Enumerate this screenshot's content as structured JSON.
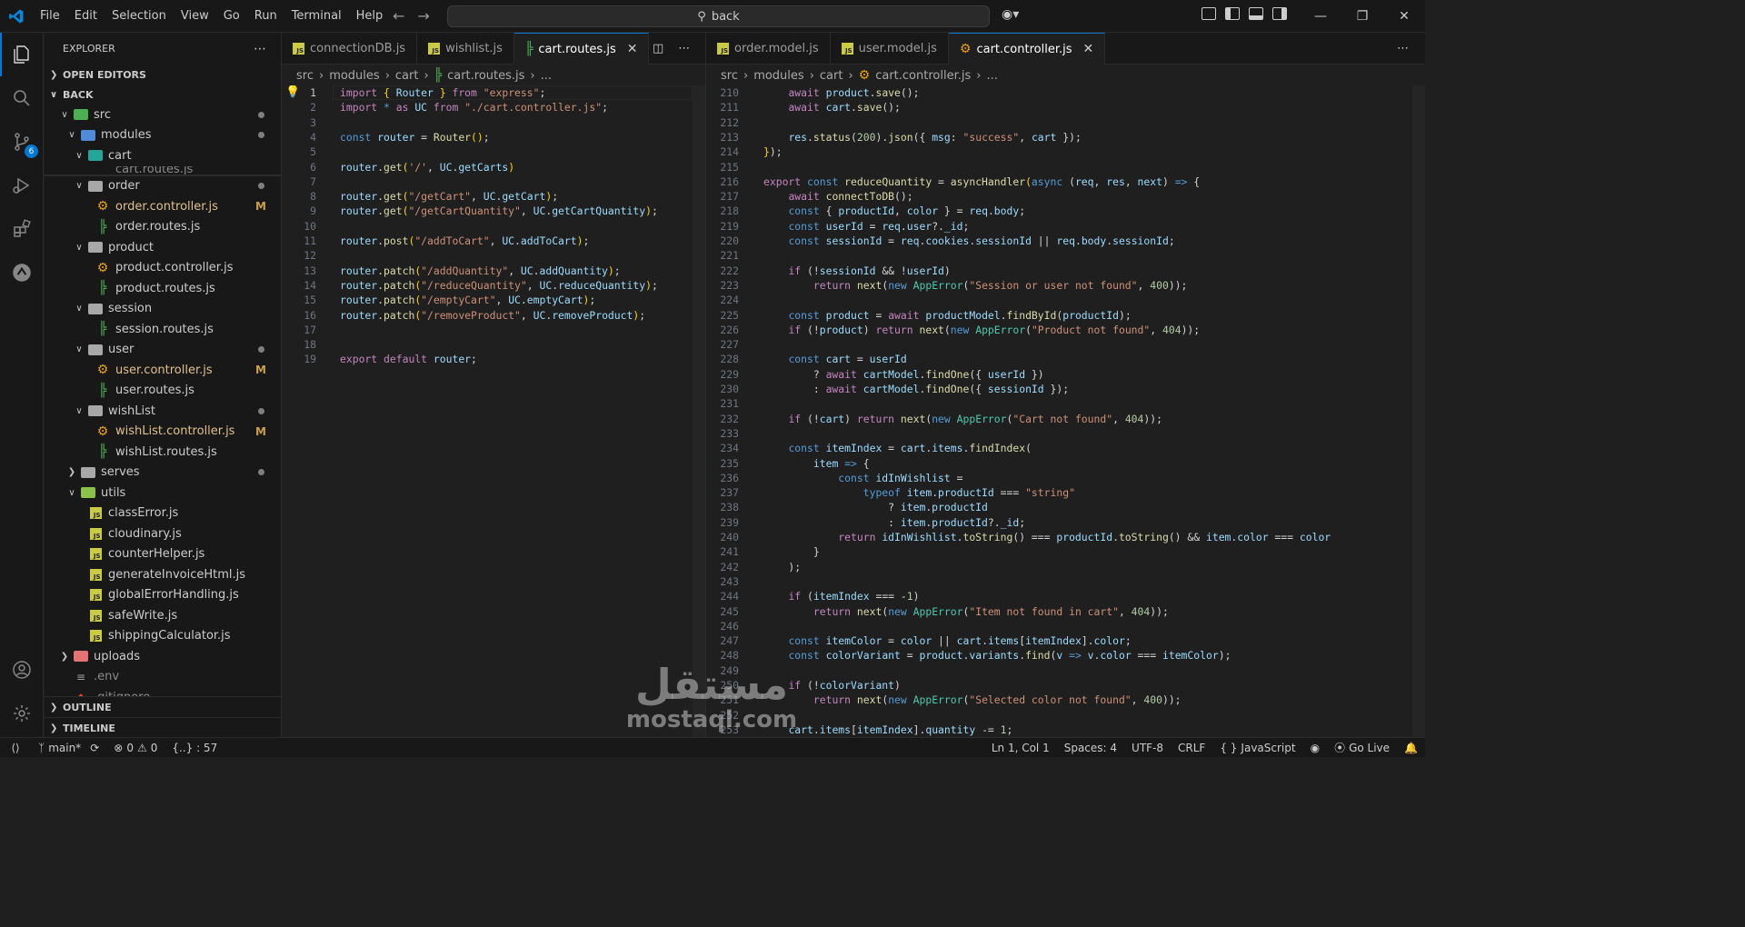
{
  "window": {
    "menu": [
      "File",
      "Edit",
      "Selection",
      "View",
      "Go",
      "Run",
      "Terminal",
      "Help"
    ],
    "search": "back"
  },
  "activity_bar": {
    "source_control_badge": "6"
  },
  "explorer": {
    "title": "EXPLORER",
    "open_editors": "OPEN EDITORS",
    "root": "BACK",
    "outline": "OUTLINE",
    "timeline": "TIMELINE",
    "sticky_hidden_file": "cart.routes.js",
    "tree": [
      {
        "label": "src",
        "depth": 1,
        "kind": "folder-src",
        "open": true,
        "dot": true
      },
      {
        "label": "modules",
        "depth": 2,
        "kind": "folder-modules",
        "open": true,
        "dot": true
      },
      {
        "label": "cart",
        "depth": 3,
        "kind": "folder-cart",
        "open": true,
        "dot": false
      },
      {
        "label": "order",
        "depth": 3,
        "kind": "folder",
        "open": true,
        "dot": true
      },
      {
        "label": "order.controller.js",
        "depth": 4,
        "kind": "controller",
        "modified": "M"
      },
      {
        "label": "order.routes.js",
        "depth": 4,
        "kind": "route"
      },
      {
        "label": "product",
        "depth": 3,
        "kind": "folder",
        "open": true
      },
      {
        "label": "product.controller.js",
        "depth": 4,
        "kind": "controller"
      },
      {
        "label": "product.routes.js",
        "depth": 4,
        "kind": "route"
      },
      {
        "label": "session",
        "depth": 3,
        "kind": "folder",
        "open": true
      },
      {
        "label": "session.routes.js",
        "depth": 4,
        "kind": "route"
      },
      {
        "label": "user",
        "depth": 3,
        "kind": "folder",
        "open": true,
        "dot": true
      },
      {
        "label": "user.controller.js",
        "depth": 4,
        "kind": "controller",
        "modified": "M"
      },
      {
        "label": "user.routes.js",
        "depth": 4,
        "kind": "route"
      },
      {
        "label": "wishList",
        "depth": 3,
        "kind": "folder",
        "open": true,
        "dot": true
      },
      {
        "label": "wishList.controller.js",
        "depth": 4,
        "kind": "controller",
        "modified": "M"
      },
      {
        "label": "wishList.routes.js",
        "depth": 4,
        "kind": "route"
      },
      {
        "label": "serves",
        "depth": 2,
        "kind": "folder",
        "open": false,
        "dot": true
      },
      {
        "label": "utils",
        "depth": 2,
        "kind": "folder-utils",
        "open": true
      },
      {
        "label": "classError.js",
        "depth": 3,
        "kind": "js"
      },
      {
        "label": "cloudinary.js",
        "depth": 3,
        "kind": "js"
      },
      {
        "label": "counterHelper.js",
        "depth": 3,
        "kind": "js"
      },
      {
        "label": "generateInvoiceHtml.js",
        "depth": 3,
        "kind": "js"
      },
      {
        "label": "globalErrorHandling.js",
        "depth": 3,
        "kind": "js"
      },
      {
        "label": "safeWrite.js",
        "depth": 3,
        "kind": "js"
      },
      {
        "label": "shippingCalculator.js",
        "depth": 3,
        "kind": "js"
      },
      {
        "label": "uploads",
        "depth": 1,
        "kind": "folder-uploads",
        "open": false
      },
      {
        "label": ".env",
        "depth": 1,
        "kind": "env",
        "dim": true
      },
      {
        "label": ".gitignore",
        "depth": 1,
        "kind": "git",
        "dim": true
      }
    ]
  },
  "left_editor": {
    "tabs": [
      "connectionDB.js",
      "wishlist.js",
      "cart.routes.js"
    ],
    "active_tab": "cart.routes.js",
    "breadcrumb": [
      "src",
      "modules",
      "cart",
      "cart.routes.js",
      "..."
    ],
    "first_line": 1
  },
  "right_editor": {
    "tabs": [
      "order.model.js",
      "user.model.js",
      "cart.controller.js"
    ],
    "active_tab": "cart.controller.js",
    "breadcrumb": [
      "src",
      "modules",
      "cart",
      "cart.controller.js",
      "..."
    ],
    "first_line": 210
  },
  "status": {
    "branch": "main*",
    "errors": "0",
    "warnings": "0",
    "braces": "{..} : 57",
    "position": "Ln 1, Col 1",
    "spaces": "Spaces: 4",
    "encoding": "UTF-8",
    "eol": "CRLF",
    "language": "JavaScript",
    "golive": "Go Live"
  },
  "watermark": {
    "arabic": "مستقل",
    "latin": "mostaql.com"
  },
  "colors": {
    "accent": "#0078d4",
    "modified": "#e2c08d",
    "string": "#ce9178",
    "keyword": "#c586c0",
    "function": "#dcdcaa",
    "variable": "#9cdcfe",
    "class": "#4ec9b0"
  }
}
